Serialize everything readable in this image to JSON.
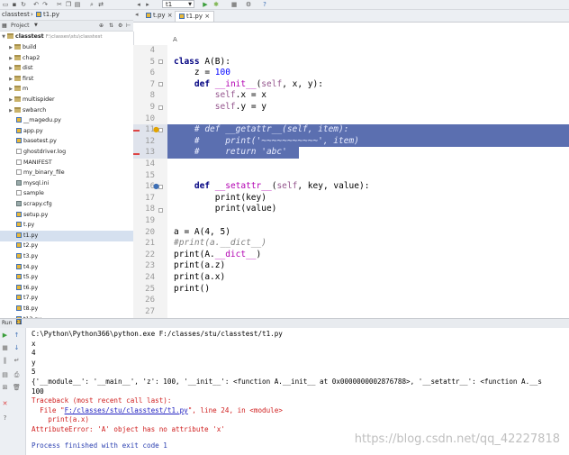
{
  "toolbar": {
    "run_config": "t1"
  },
  "project_breadcrumb": [
    "classtest",
    "t1.py"
  ],
  "editor_tabs": [
    {
      "label": "t.py",
      "active": false
    },
    {
      "label": "t1.py",
      "active": true
    }
  ],
  "editor_breadcrumb": "A",
  "project_panel": {
    "title": "Project",
    "root_label": "classtest",
    "root_path": "F:\\classes\\stu\\classtest",
    "items": [
      {
        "label": "build",
        "type": "folder"
      },
      {
        "label": "chap2",
        "type": "folder"
      },
      {
        "label": "dist",
        "type": "folder"
      },
      {
        "label": "first",
        "type": "folder"
      },
      {
        "label": "m",
        "type": "folder"
      },
      {
        "label": "multispider",
        "type": "folder"
      },
      {
        "label": "swbarch",
        "type": "folder"
      },
      {
        "label": "__magedu.py",
        "type": "py"
      },
      {
        "label": "app.py",
        "type": "py"
      },
      {
        "label": "basetest.py",
        "type": "py"
      },
      {
        "label": "ghostdriver.log",
        "type": "txt"
      },
      {
        "label": "MANIFEST",
        "type": "txt"
      },
      {
        "label": "my_binary_file",
        "type": "txt"
      },
      {
        "label": "mysql.ini",
        "type": "cfg"
      },
      {
        "label": "sample",
        "type": "txt"
      },
      {
        "label": "scrapy.cfg",
        "type": "cfg"
      },
      {
        "label": "setup.py",
        "type": "py"
      },
      {
        "label": "t.py",
        "type": "py"
      },
      {
        "label": "t1.py",
        "type": "py",
        "selected": true
      },
      {
        "label": "t2.py",
        "type": "py"
      },
      {
        "label": "t3.py",
        "type": "py"
      },
      {
        "label": "t4.py",
        "type": "py"
      },
      {
        "label": "t5.py",
        "type": "py"
      },
      {
        "label": "t6.py",
        "type": "py"
      },
      {
        "label": "t7.py",
        "type": "py"
      },
      {
        "label": "t8.py",
        "type": "py"
      },
      {
        "label": "t12.py",
        "type": "py"
      }
    ]
  },
  "editor": {
    "line_numbers": [
      "4",
      "5",
      "6",
      "7",
      "8",
      "9",
      "10",
      "11",
      "12",
      "13",
      "14",
      "15",
      "16",
      "17",
      "18",
      "19",
      "20",
      "21",
      "22",
      "23",
      "24",
      "25",
      "26",
      "27"
    ],
    "lines": {
      "l4": "",
      "l5a": "class",
      "l5b": " A(B):",
      "l6a": "    z = ",
      "l6b": "100",
      "l7a": "    ",
      "l7b": "def",
      "l7c": " ",
      "l7d": "__init__",
      "l7e": "(",
      "l7f": "self",
      "l7g": ", x, y):",
      "l8a": "        ",
      "l8b": "self",
      "l8c": ".x = x",
      "l9a": "        ",
      "l9b": "self",
      "l9c": ".y = y",
      "l11": "    # def __getattr__(self, item):",
      "l12": "    #     print('~~~~~~~~~~~', item)",
      "l13": "    #     return 'abc'",
      "l16a": "    ",
      "l16b": "def",
      "l16c": " ",
      "l16d": "__setattr__",
      "l16e": "(",
      "l16f": "self",
      "l16g": ", key, value):",
      "l17": "        print(key)",
      "l18": "        print(value)",
      "l20": "a = A(4, 5)",
      "l21": "#print(a.__dict__)",
      "l22a": "print(A.",
      "l22b": "__dict__",
      "l22c": ")",
      "l23": "print(a.z)",
      "l24": "print(a.x)",
      "l25": "print()"
    }
  },
  "run_panel": {
    "title": "Run",
    "tab": "t1",
    "output": [
      "C:\\Python\\Python366\\python.exe F:/classes/stu/classtest/t1.py",
      "x",
      "4",
      "y",
      "5",
      "{'__module__': '__main__', 'z': 100, '__init__': <function A.__init__ at 0x0000000002876788>, '__setattr__': <function A.__s",
      "100"
    ],
    "traceback_header": "Traceback (most recent call last):",
    "traceback_file_prefix": "  File \"",
    "traceback_file_link": "F:/classes/stu/classtest/t1.py",
    "traceback_file_suffix": "\", line 24, in <module>",
    "traceback_code": "    print(a.x)",
    "error": "AttributeError: 'A' object has no attribute 'x'",
    "finished": "Process finished with exit code 1"
  },
  "watermark": "https://blog.csdn.net/qq_42227818"
}
